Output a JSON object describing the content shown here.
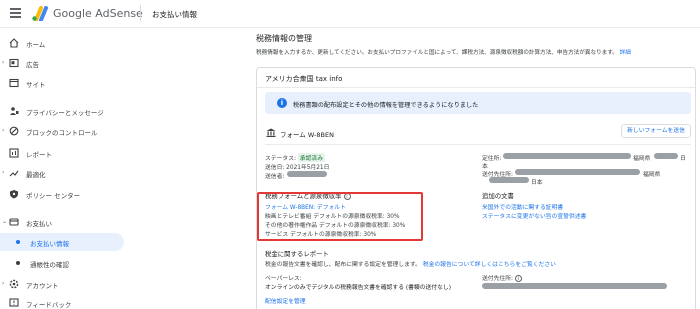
{
  "app": {
    "brand": "Google AdSense",
    "page_title": "お支払い情報"
  },
  "sidebar": {
    "items": [
      {
        "label": "ホーム",
        "icon": "home-icon"
      },
      {
        "label": "広告",
        "icon": "ads-icon"
      },
      {
        "label": "サイト",
        "icon": "sites-icon"
      },
      {
        "label": "プライバシーとメッセージ",
        "icon": "privacy-icon"
      },
      {
        "label": "ブロックのコントロール",
        "icon": "block-icon"
      },
      {
        "label": "レポート",
        "icon": "reports-icon"
      },
      {
        "label": "最適化",
        "icon": "optimization-icon"
      },
      {
        "label": "ポリシー センター",
        "icon": "policy-icon"
      },
      {
        "label": "お支払い",
        "icon": "payments-icon"
      },
      {
        "label": "お支払い情報",
        "active": true
      },
      {
        "label": "通帳性の確認"
      },
      {
        "label": "アカウント",
        "icon": "account-icon"
      },
      {
        "label": "フィードバック",
        "icon": "feedback-icon"
      }
    ]
  },
  "main": {
    "section_title": "税務情報の管理",
    "section_desc": "税務情報を入力するか、更新してください。お支払いプロファイルと国によって、課税方法、源泉徴収税額の計算方法、申告方法が異なります。",
    "section_desc_link": "詳細",
    "card": {
      "title": "アメリカ合衆国 tax info",
      "info_banner": "税務書類の配布設定とその他の情報を管理できるようになりました",
      "form_name": "フォーム W-8BEN",
      "new_form_button": "新しいフォームを送信",
      "status_label": "ステータス:",
      "status_value": "承認済み",
      "sent_date": "送信日: 2021年5月21日",
      "sender": "送信者:",
      "residence_label": "定住所:",
      "residence_suffix_1": "福岡県",
      "residence_suffix_2": "日",
      "residence_suffix_3": "本",
      "mailing_label": "送付先住所:",
      "mailing_suffix_1": "福岡県",
      "mailing_suffix_2": "日本",
      "tax_forms_heading": "税務フォームと源泉徴収率",
      "tax_form_link": "フォーム W-8BEN: デフォルト",
      "rates": [
        "映画とテレビ番組 デフォルトの源泉徴収税率: 30%",
        "その他の著作権作品 デフォルトの源泉徴収税率: 30%",
        "サービス デフォルトの源泉徴収税率: 30%"
      ],
      "additional_docs_heading": "追加の文書",
      "additional_docs_links": [
        "米国外での活動に関する証明書",
        "ステータスに変更がない旨の宣誓供述書"
      ],
      "tax_reports_heading": "税金に関するレポート",
      "tax_reports_desc": "税金の報告文書を確認し、配布に関する設定を管理します。",
      "tax_reports_link": "税金の報告について詳しくはこちらをご覧ください",
      "paperless_label": "ペーパーレス:",
      "paperless_desc": "オンラインのみでデジタルの税務報告文書を確認する (書類の送付なし)",
      "delivery_settings_link": "配信設定を管理",
      "recipient_address_label": "送付先住所:"
    }
  },
  "colors": {
    "accent": "#1a73e8",
    "highlight_box": "#e53935",
    "approved_bg": "#e6f4ea",
    "approved_text": "#137333",
    "banner_bg": "#e8f0fe"
  }
}
